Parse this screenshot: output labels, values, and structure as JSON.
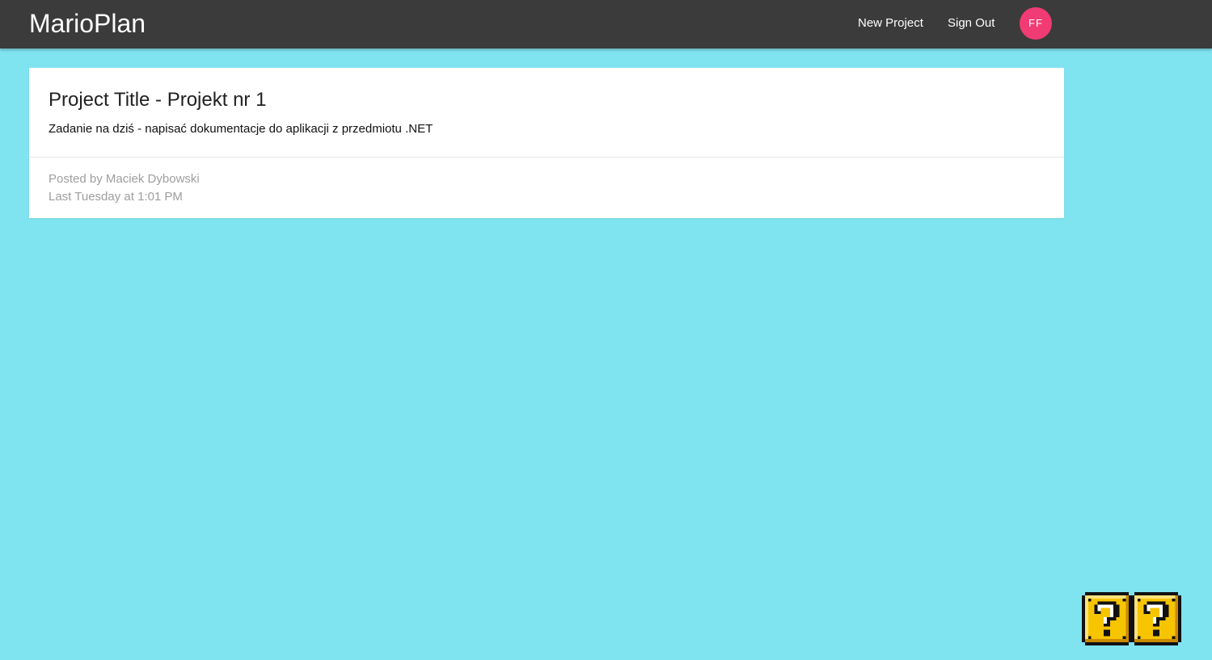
{
  "navbar": {
    "brand": "MarioPlan",
    "links": [
      {
        "label": "New Project"
      },
      {
        "label": "Sign Out"
      }
    ],
    "avatar_initials": "FF",
    "colors": {
      "bar": "#3b3b3b",
      "avatar": "#f03b74"
    }
  },
  "project": {
    "title": "Project Title - Projekt nr 1",
    "content": "Zadanie na dziś - napisać dokumentacje do aplikacji z przedmiotu .NET",
    "author": "Posted by Maciek Dybowski",
    "date": "Last Tuesday at 1:01 PM"
  },
  "decoration": {
    "icons": [
      "question-block-icon",
      "question-block-icon"
    ]
  },
  "colors": {
    "background": "#80e3f0",
    "card": "#ffffff"
  }
}
